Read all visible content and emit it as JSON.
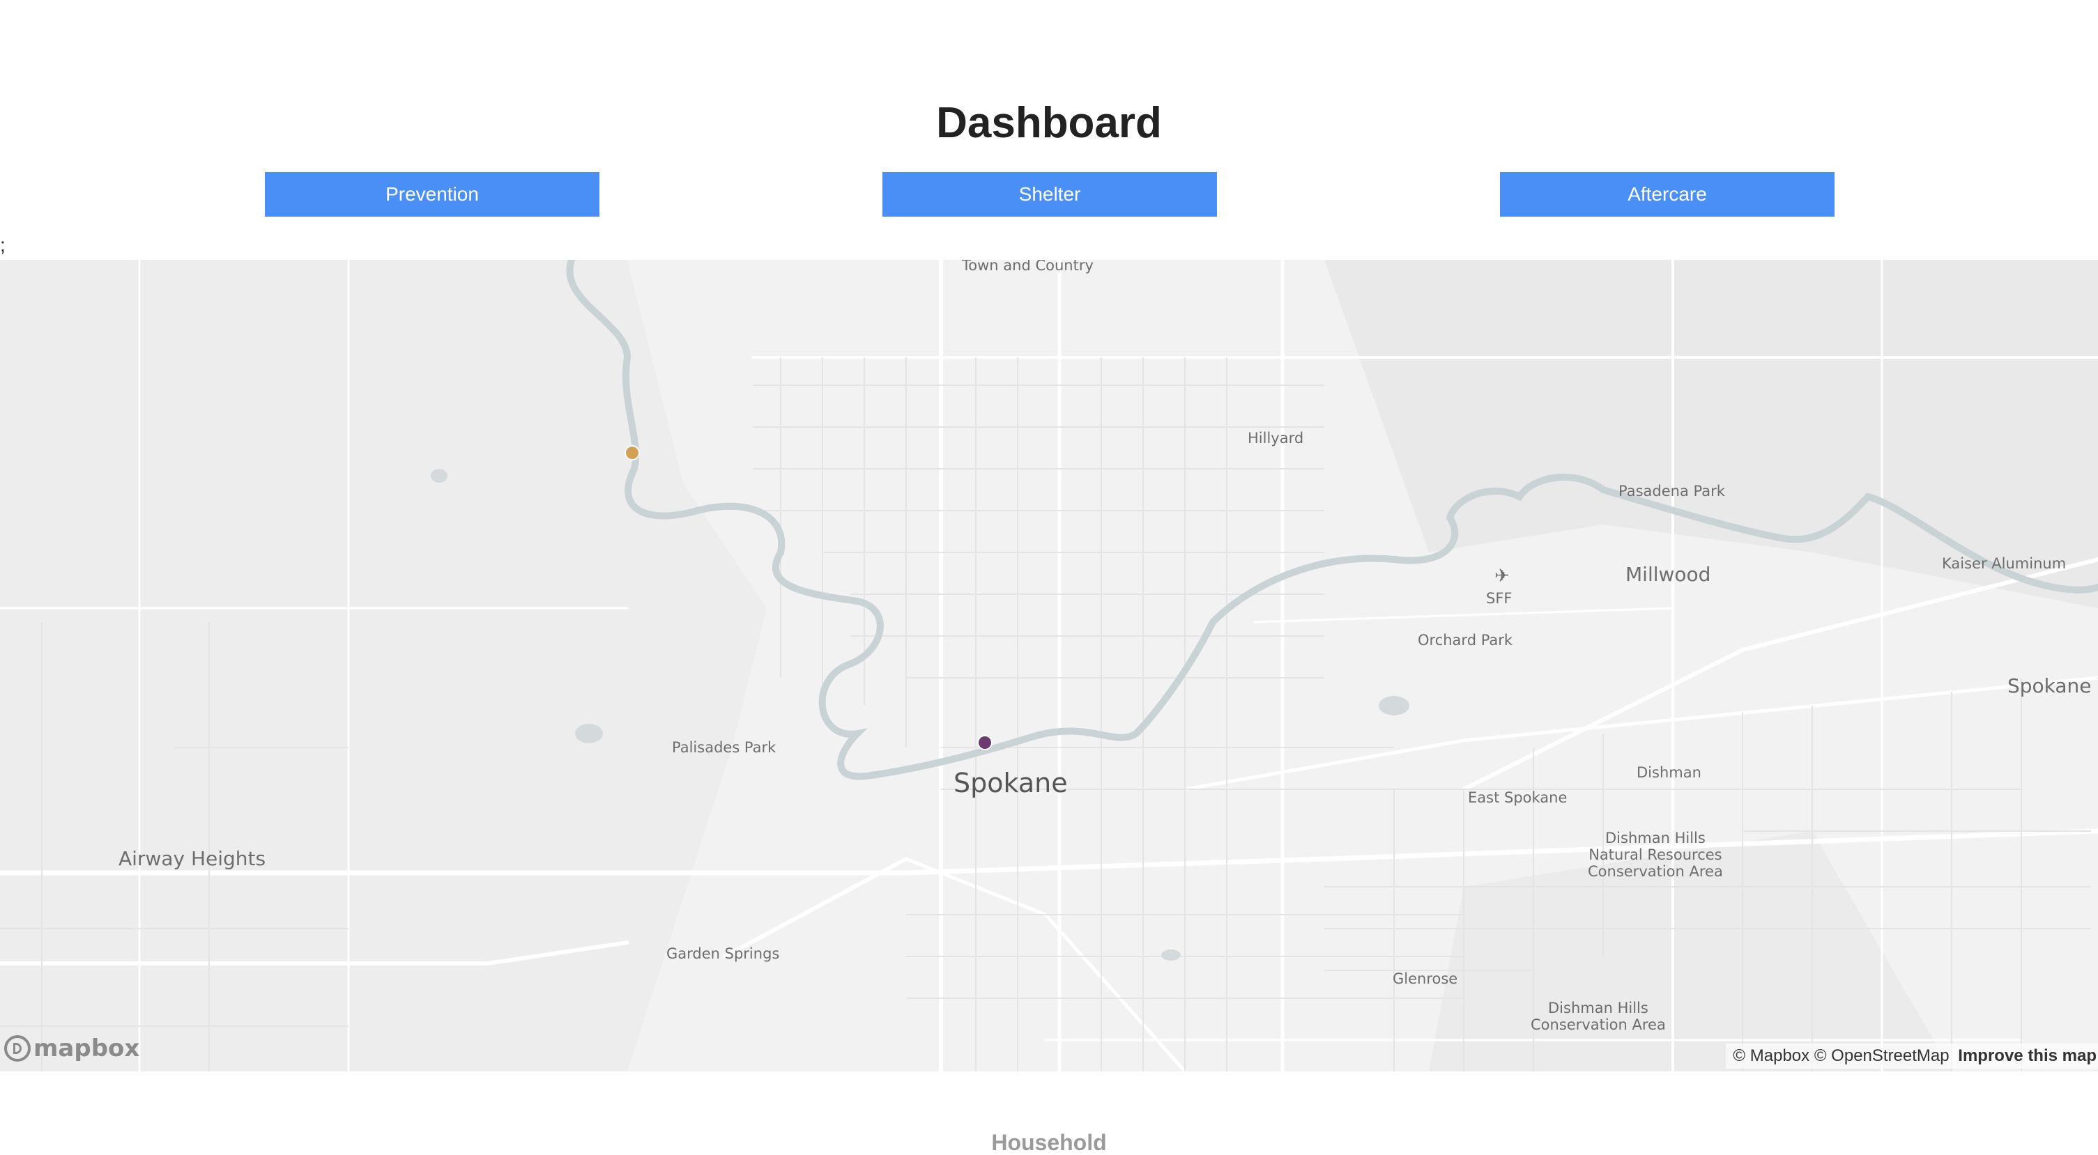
{
  "page": {
    "title": "Dashboard",
    "stray_text": ";",
    "section_heading": "Household"
  },
  "tabs": [
    {
      "label": "Prevention"
    },
    {
      "label": "Shelter"
    },
    {
      "label": "Aftercare"
    }
  ],
  "colors": {
    "button": "#4a8ff5",
    "marker_prevention": "#d4a055",
    "marker_shelter": "#6b3a6e",
    "water": "#c9d2d4",
    "land": "#f2f2f2"
  },
  "map": {
    "labels": {
      "town_country": "Town and\nCountry",
      "hillyard": "Hillyard",
      "pasadena_park": "Pasadena Park",
      "kaiser_aluminum": "Kaiser Aluminum",
      "millwood": "Millwood",
      "sff": "SFF",
      "orchard_park": "Orchard Park",
      "spokane_valley": "Spokane V",
      "palisades_park": "Palisades Park",
      "spokane": "Spokane",
      "dishman": "Dishman",
      "east_spokane": "East Spokane",
      "dishman_hills_nra": "Dishman Hills\nNatural Resources\nConservation Area",
      "airway_heights": "Airway Heights",
      "garden_springs": "Garden Springs",
      "glenrose": "Glenrose",
      "dishman_hills_ca": "Dishman Hills\nConservation Area"
    },
    "airport_icon": "airplane-icon",
    "logo_text": "mapbox",
    "attribution": {
      "mapbox": "© Mapbox",
      "osm": "© OpenStreetMap",
      "improve": "Improve this map"
    }
  }
}
